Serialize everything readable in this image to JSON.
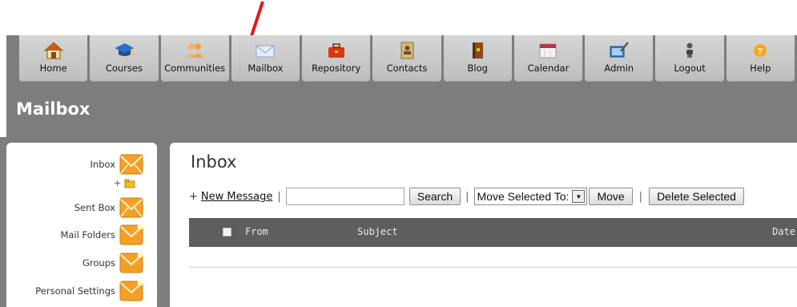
{
  "nav": {
    "items": [
      {
        "label": "Home",
        "icon": "home-icon"
      },
      {
        "label": "Courses",
        "icon": "graduation-cap-icon"
      },
      {
        "label": "Communities",
        "icon": "people-icon"
      },
      {
        "label": "Mailbox",
        "icon": "envelope-icon"
      },
      {
        "label": "Repository",
        "icon": "briefcase-icon"
      },
      {
        "label": "Contacts",
        "icon": "address-book-icon"
      },
      {
        "label": "Blog",
        "icon": "book-icon"
      },
      {
        "label": "Calendar",
        "icon": "calendar-icon"
      },
      {
        "label": "Admin",
        "icon": "admin-icon"
      },
      {
        "label": "Logout",
        "icon": "user-logout-icon"
      },
      {
        "label": "Help",
        "icon": "help-icon"
      }
    ]
  },
  "module_title": "Mailbox",
  "sidebar": {
    "items": [
      {
        "label": "Inbox"
      },
      {
        "label": "Sent Box"
      },
      {
        "label": "Mail Folders"
      },
      {
        "label": "Groups"
      },
      {
        "label": "Personal Settings"
      }
    ],
    "add_folder_symbol": "+"
  },
  "content": {
    "title": "Inbox",
    "toolbar": {
      "new_prefix": "+",
      "new_message_label": "New Message",
      "separator": "|",
      "search_label": "Search",
      "move_select_value": "Move Selected To:",
      "move_label": "Move",
      "delete_label": "Delete Selected"
    },
    "table": {
      "columns": [
        "From",
        "Subject",
        "Date"
      ]
    }
  },
  "colors": {
    "frame_gray": "#7d7d7d",
    "header_gray": "#5e5e5e",
    "envelope_orange": "#f5a023",
    "arrow_red": "#e0191b"
  }
}
